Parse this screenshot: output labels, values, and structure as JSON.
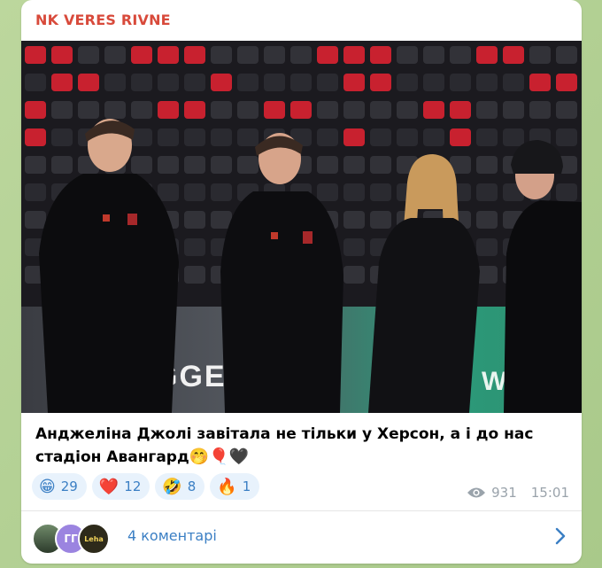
{
  "post": {
    "channel_name": "NK VERES RIVNE",
    "caption_text": "Анджеліна Джолі завітала не тільки у Херсон, а і до нас стадіон Авангард",
    "caption_emojis": "🤭🎈🖤",
    "banner_text_left": "GGE",
    "banner_text_right": "WEN"
  },
  "reactions": [
    {
      "emoji": "😁",
      "count": "29"
    },
    {
      "emoji": "❤️",
      "count": "12"
    },
    {
      "emoji": "🤣",
      "count": "8"
    },
    {
      "emoji": "🔥",
      "count": "1"
    }
  ],
  "meta": {
    "views": "931",
    "time": "15:01",
    "icon": "eye-icon"
  },
  "comments": {
    "label": "4 коментарі",
    "avatar_initials": "ГГ",
    "avatar_label": "Leha",
    "chevron_icon": "chevron-right-icon"
  },
  "colors": {
    "channel": "#d84a3b",
    "link": "#3b7fc4",
    "reaction_bg": "#e8f2fc"
  }
}
